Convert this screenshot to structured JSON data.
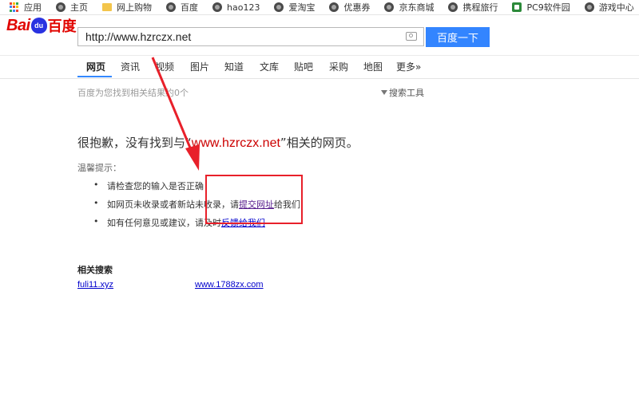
{
  "bookmarks": [
    {
      "label": "应用",
      "icon": "apps-grid-icon"
    },
    {
      "label": "主页",
      "icon": "globe-icon"
    },
    {
      "label": "网上购物",
      "icon": "folder-icon"
    },
    {
      "label": "百度",
      "icon": "globe-icon"
    },
    {
      "label": "hao123",
      "icon": "globe-icon"
    },
    {
      "label": "爱淘宝",
      "icon": "globe-icon"
    },
    {
      "label": "优惠券",
      "icon": "globe-icon"
    },
    {
      "label": "京东商城",
      "icon": "globe-icon"
    },
    {
      "label": "携程旅行",
      "icon": "globe-icon"
    },
    {
      "label": "PC9软件园",
      "icon": "pc9-icon"
    },
    {
      "label": "游戏中心",
      "icon": "globe-icon"
    }
  ],
  "logo": {
    "bai": "Bai",
    "du": "du",
    "cn": "百度"
  },
  "search": {
    "value": "http://www.hzrczx.net",
    "button": "百度一下"
  },
  "tabs": [
    "网页",
    "资讯",
    "视频",
    "图片",
    "知道",
    "文库",
    "贴吧",
    "采购",
    "地图",
    "更多»"
  ],
  "result_count": "百度为您找到相关结果约0个",
  "search_tools": "搜索工具",
  "sorry": {
    "prefix": "很抱歉，没有找到与“",
    "keyword": "www.hzrczx.net",
    "suffix": "”相关的网页。"
  },
  "tips": {
    "title": "温馨提示：",
    "items": [
      {
        "text": "请检查您的输入是否正确"
      },
      {
        "text": "如网页未收录或者新站未收录，请",
        "link": "提交网址",
        "after": "给我们"
      },
      {
        "text": "如有任何意见或建议，请及时",
        "link": "反馈给我们"
      }
    ]
  },
  "related": {
    "title": "相关搜索",
    "links": [
      "fuli11.xyz",
      "www.1788zx.com"
    ]
  },
  "colors": {
    "accent": "#3385ff",
    "annotation": "#e8202a",
    "keyword": "#cc0000"
  }
}
